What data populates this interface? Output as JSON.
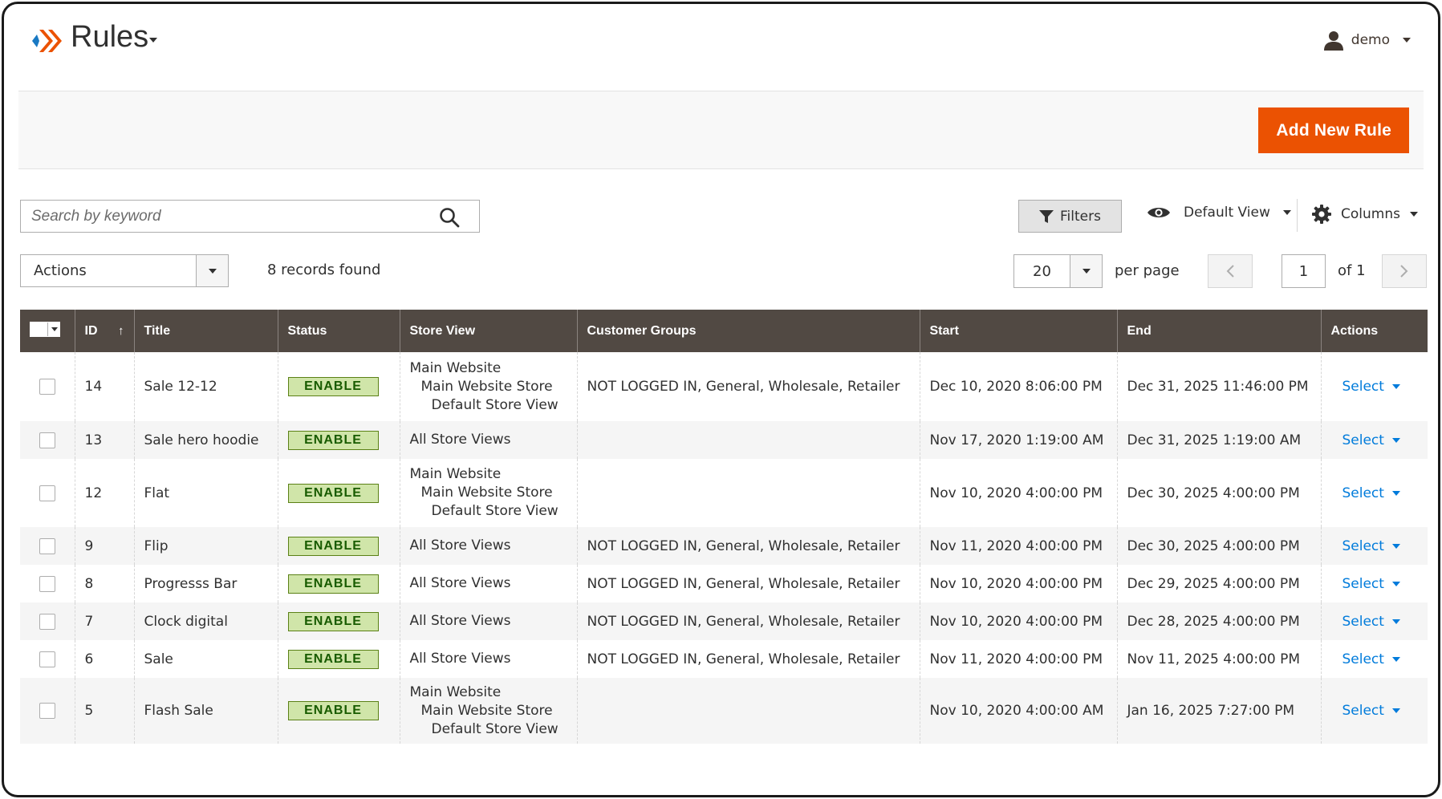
{
  "header": {
    "title": "Rules",
    "user_name": "demo"
  },
  "actionbar": {
    "add_label": "Add New Rule"
  },
  "toolbar": {
    "search_placeholder": "Search by keyword",
    "filters_label": "Filters",
    "view_label": "Default View",
    "columns_label": "Columns",
    "actions_label": "Actions",
    "records_found": "8 records found",
    "per_page_value": "20",
    "per_page_label": "per page",
    "page_value": "1",
    "page_of": "of 1"
  },
  "colors": {
    "accent": "#eb5202",
    "header_bg": "#514943",
    "link": "#007bdb",
    "badge_bg": "#d0e5a9",
    "badge_text": "#185b00"
  },
  "table": {
    "columns": [
      "ID",
      "Title",
      "Status",
      "Store View",
      "Customer Groups",
      "Start",
      "End",
      "Actions"
    ],
    "sort_indicator": "↑",
    "rows": [
      {
        "id": "14",
        "title": "Sale 12-12",
        "status": "ENABLE",
        "store": [
          "Main Website",
          "Main Website Store",
          "Default Store View"
        ],
        "groups": "NOT LOGGED IN, General, Wholesale, Retailer",
        "start": "Dec 10, 2020 8:06:00 PM",
        "end": "Dec 31, 2025 11:46:00 PM",
        "action": "Select"
      },
      {
        "id": "13",
        "title": "Sale hero hoodie",
        "status": "ENABLE",
        "store": [
          "All Store Views"
        ],
        "groups": "",
        "start": "Nov 17, 2020 1:19:00 AM",
        "end": "Dec 31, 2025 1:19:00 AM",
        "action": "Select"
      },
      {
        "id": "12",
        "title": "Flat",
        "status": "ENABLE",
        "store": [
          "Main Website",
          "Main Website Store",
          "Default Store View"
        ],
        "groups": "",
        "start": "Nov 10, 2020 4:00:00 PM",
        "end": "Dec 30, 2025 4:00:00 PM",
        "action": "Select"
      },
      {
        "id": "9",
        "title": "Flip",
        "status": "ENABLE",
        "store": [
          "All Store Views"
        ],
        "groups": "NOT LOGGED IN, General, Wholesale, Retailer",
        "start": "Nov 11, 2020 4:00:00 PM",
        "end": "Dec 30, 2025 4:00:00 PM",
        "action": "Select"
      },
      {
        "id": "8",
        "title": "Progresss Bar",
        "status": "ENABLE",
        "store": [
          "All Store Views"
        ],
        "groups": "NOT LOGGED IN, General, Wholesale, Retailer",
        "start": "Nov 10, 2020 4:00:00 PM",
        "end": "Dec 29, 2025 4:00:00 PM",
        "action": "Select"
      },
      {
        "id": "7",
        "title": "Clock digital",
        "status": "ENABLE",
        "store": [
          "All Store Views"
        ],
        "groups": "NOT LOGGED IN, General, Wholesale, Retailer",
        "start": "Nov 10, 2020 4:00:00 PM",
        "end": "Dec 28, 2025 4:00:00 PM",
        "action": "Select"
      },
      {
        "id": "6",
        "title": "Sale",
        "status": "ENABLE",
        "store": [
          "All Store Views"
        ],
        "groups": "NOT LOGGED IN, General, Wholesale, Retailer",
        "start": "Nov 11, 2020 4:00:00 PM",
        "end": "Nov 11, 2025 4:00:00 PM",
        "action": "Select"
      },
      {
        "id": "5",
        "title": "Flash Sale",
        "status": "ENABLE",
        "store": [
          "Main Website",
          "Main Website Store",
          "Default Store View"
        ],
        "groups": "",
        "start": "Nov 10, 2020 4:00:00 AM",
        "end": "Jan 16, 2025 7:27:00 PM",
        "action": "Select"
      }
    ]
  }
}
